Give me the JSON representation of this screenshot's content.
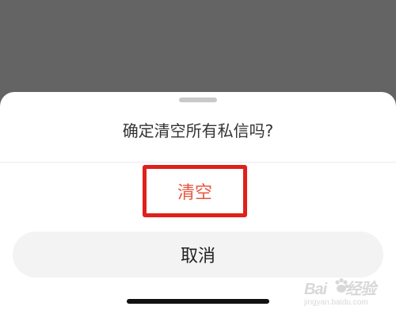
{
  "dialog": {
    "prompt": "确定清空所有私信吗?",
    "confirm_label": "清空",
    "cancel_label": "取消"
  },
  "watermark": {
    "logo_text": "Bai",
    "logo_text_2": "经验",
    "url": "jingyan.baidu.com"
  },
  "colors": {
    "overlay": "#646464",
    "sheet": "#ffffff",
    "confirm_text": "#e8553e",
    "highlight_box": "#e0201a",
    "cancel_bg": "#f3f3f3"
  },
  "icons": {
    "handle": "drag-handle",
    "paw": "baidu-paw-icon"
  }
}
